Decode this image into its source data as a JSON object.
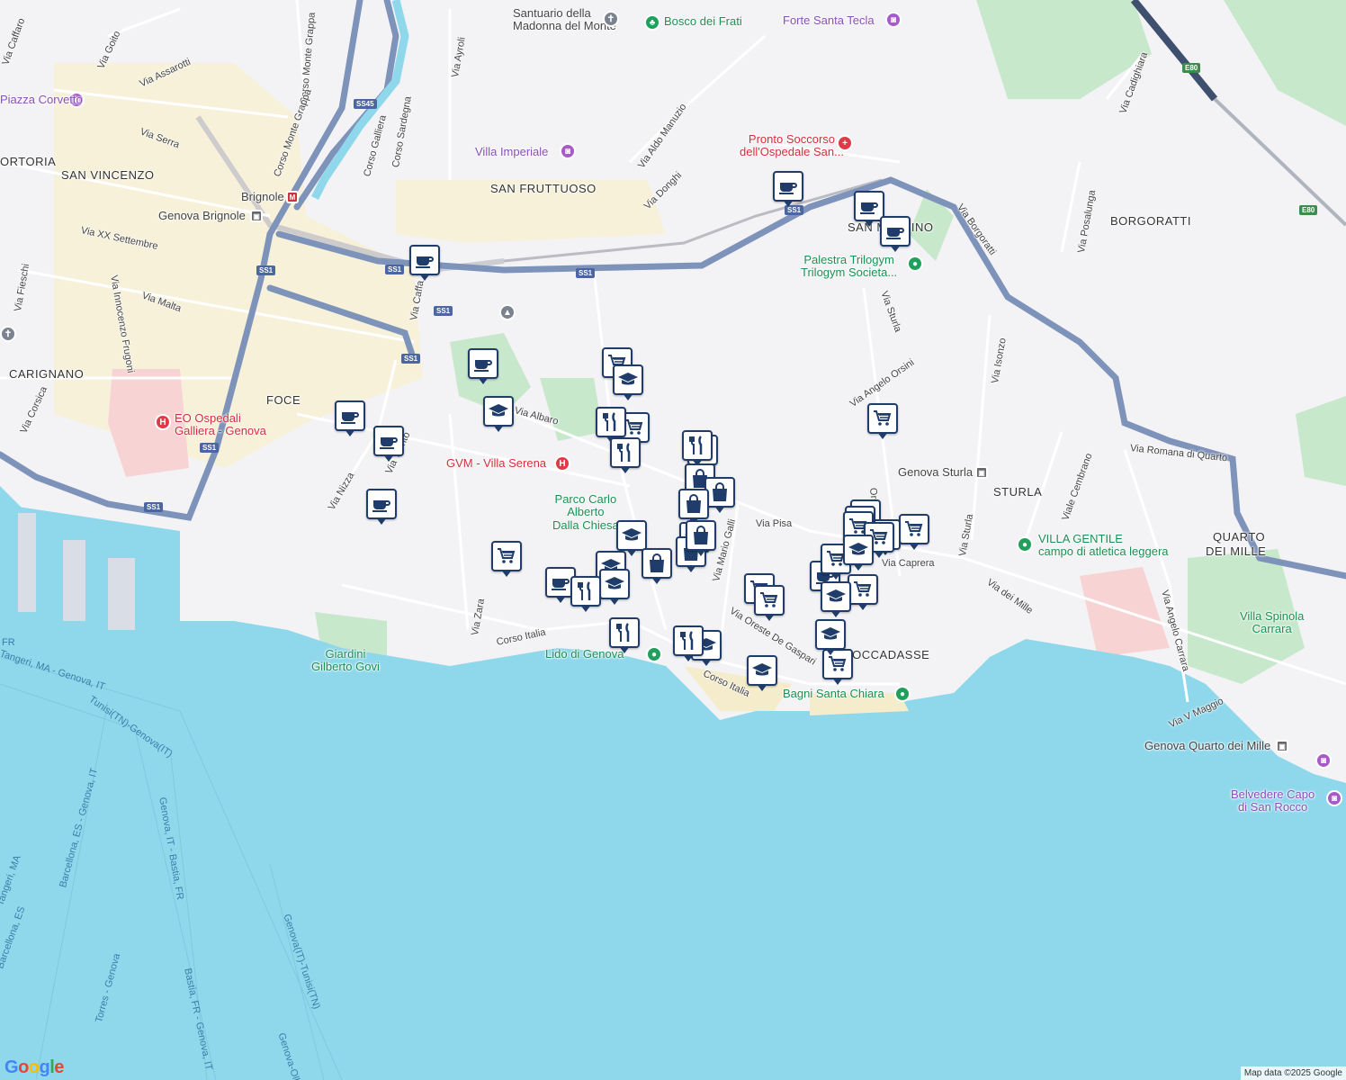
{
  "districts": [
    {
      "text": "SAN VINCENZO"
    },
    {
      "text": "SAN FRUTTUOSO"
    },
    {
      "text": "CARIGNANO"
    },
    {
      "text": "FOCE"
    },
    {
      "text": "BORGORATTI"
    },
    {
      "text": "STURLA"
    },
    {
      "text": "QUARTO"
    },
    {
      "text": "DEI MILLE"
    },
    {
      "text": "SAN MARTINO"
    },
    {
      "text": "BOCCADASSE"
    },
    {
      "text": "ORTORIA"
    }
  ],
  "streets": [
    "Via Caffaro",
    "Via Goito",
    "Via Assarotti",
    "Corso Monte Grappa",
    "Via Ayroli",
    "Via Serra",
    "Corso Galliera",
    "Corso Sardegna",
    "Corso Monte Grappa",
    "Via XX Settembre",
    "Via Fieschi",
    "Via Innocenzo Frugoni",
    "Via Malta",
    "Via Corsica",
    "Via Caffa",
    "Via Nizza",
    "Via Trento",
    "Via Albaro",
    "Via Zara",
    "Corso Italia",
    "Via Aldo Manuzio",
    "Via Donghi",
    "Via Borgoratti",
    "Via Sturla",
    "Via Angelo Orsini",
    "Via Isonzo",
    "Via Cadighiara",
    "Via Posalunga",
    "Via Romana di Quarto",
    "Viale Cembrano",
    "Via Sturla",
    "Via Caprera",
    "Via dei Mille",
    "Via Angelo Carrara",
    "Via V Maggio",
    "Via Pisa",
    "Via Mario Galli",
    "Via Oreste De Gaspari",
    "Corso Italia",
    "Orsini"
  ],
  "pois": [
    {
      "name": "Santuario della",
      "name2": "Madonna del Monte"
    },
    {
      "name": "Bosco dei Frati"
    },
    {
      "name": "Forte Santa Tecla"
    },
    {
      "name": "Piazza Corvetto"
    },
    {
      "name": "Villa Imperiale"
    },
    {
      "name": "Pronto Soccorso",
      "name2": "dell'Ospedale San..."
    },
    {
      "name": "Brignole"
    },
    {
      "name": "Genova Brignole"
    },
    {
      "name": "Palestra Trilogym",
      "name2": "Trilogym Societa..."
    },
    {
      "name": "EO Ospedali",
      "name2": "Galliera - Genova"
    },
    {
      "name": "GVM - Villa Serena"
    },
    {
      "name": "Parco Carlo",
      "name2": "Alberto",
      "name3": "Dalla Chiesa"
    },
    {
      "name": "Genova Sturla"
    },
    {
      "name": "VILLA GENTILE",
      "name2": "campo di atletica leggera"
    },
    {
      "name": "Villa Spinola",
      "name2": "Carrara"
    },
    {
      "name": "Giardini",
      "name2": "Gilberto Govi"
    },
    {
      "name": "Lido di Genova"
    },
    {
      "name": "Bagni Santa Chiara"
    },
    {
      "name": "Genova Quarto dei Mille"
    },
    {
      "name": "Belvedere Capo",
      "name2": "di San Rocco"
    }
  ],
  "road_shields": [
    "SS45",
    "SS1",
    "SS1",
    "SS1",
    "SS1",
    "SS1",
    "SS1",
    "SS1",
    "SS1",
    "E80",
    "E80"
  ],
  "sea_routes": [
    "Tangeri, MA - Genova, IT",
    "Tunisi(TN)-Genova(IT)",
    "Barcellona, ES - Genova, IT",
    "Genova, IT - Bastia, FR",
    "Genova(IT)-Tunisi(TN)",
    "Bastia, FR - Genova, IT",
    "Genova-Olbia",
    "Torres - Genova",
    "Tangeri, MA",
    "Barcellona, ES",
    "FR"
  ],
  "markers": [
    {
      "icon": "coffee"
    },
    {
      "icon": "coffee"
    },
    {
      "icon": "coffee"
    },
    {
      "icon": "coffee"
    },
    {
      "icon": "coffee"
    },
    {
      "icon": "coffee"
    },
    {
      "icon": "coffee"
    },
    {
      "icon": "coffee"
    },
    {
      "icon": "coffee"
    },
    {
      "icon": "coffee"
    },
    {
      "icon": "coffee"
    },
    {
      "icon": "cart"
    },
    {
      "icon": "cart"
    },
    {
      "icon": "cart"
    },
    {
      "icon": "cart"
    },
    {
      "icon": "cart"
    },
    {
      "icon": "cart"
    },
    {
      "icon": "cart"
    },
    {
      "icon": "cart"
    },
    {
      "icon": "cart"
    },
    {
      "icon": "cart"
    },
    {
      "icon": "cart"
    },
    {
      "icon": "cart"
    },
    {
      "icon": "cart"
    },
    {
      "icon": "cart"
    },
    {
      "icon": "school"
    },
    {
      "icon": "school"
    },
    {
      "icon": "school"
    },
    {
      "icon": "school"
    },
    {
      "icon": "school"
    },
    {
      "icon": "school"
    },
    {
      "icon": "school"
    },
    {
      "icon": "school"
    },
    {
      "icon": "school"
    },
    {
      "icon": "school"
    },
    {
      "icon": "school"
    },
    {
      "icon": "restaurant"
    },
    {
      "icon": "restaurant"
    },
    {
      "icon": "restaurant"
    },
    {
      "icon": "restaurant"
    },
    {
      "icon": "restaurant"
    },
    {
      "icon": "restaurant"
    },
    {
      "icon": "restaurant"
    },
    {
      "icon": "bag"
    },
    {
      "icon": "bag"
    },
    {
      "icon": "bag"
    },
    {
      "icon": "bag"
    },
    {
      "icon": "bag"
    },
    {
      "icon": "bag"
    }
  ],
  "attribution": "Map data ©2025 Google",
  "logo": "Google",
  "colors": {
    "sea": "#8fd8ec",
    "land": "#f3f3f6",
    "highway": "#7e93ba",
    "marker_border": "#1f3c6b",
    "park": "#c8e8cc",
    "city_center": "#faf0c8"
  }
}
